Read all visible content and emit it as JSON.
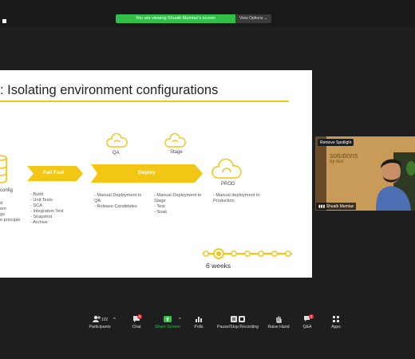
{
  "share_banner": {
    "text": "You are viewing Shuaib Mumtaz's screen",
    "view_options": "View Options"
  },
  "slide": {
    "title": ": Isolating environment configurations",
    "config_fragment": "config",
    "left_bullets": [
      "d",
      "ent",
      "gs",
      "e principle"
    ],
    "stages": {
      "fail_fast": "Fail Fast",
      "deploy": "Deploy",
      "qa": "QA",
      "stage": "Stage",
      "prod": "PROD"
    },
    "fail_fast_bullets": [
      "Build",
      "Unit Tests",
      "SCA",
      "Integration Test",
      "Snapshot",
      "Archive"
    ],
    "qa_bullets": [
      "Manual Deployment to QA",
      "Release Candidates"
    ],
    "stage_bullets": [
      "Manual Deployment to Stage",
      "Test",
      "Soak"
    ],
    "prod_bullets": [
      "Manual deployment to Production"
    ],
    "timeline": "6 weeks"
  },
  "video": {
    "remove_spotlight": "Remove Spotlight",
    "name": "Shuaib Mumtaz",
    "logo_lines": [
      "solutions",
      "by text"
    ]
  },
  "toolbar": {
    "participants": "Participants",
    "participants_count": "102",
    "chat": "Chat",
    "chat_badge": "1",
    "share": "Share Screen",
    "polls": "Polls",
    "recording": "Pause/Stop Recording",
    "raise_hand": "Raise Hand",
    "qa": "Q&A",
    "qa_badge": "1",
    "apps": "Apps"
  },
  "colors": {
    "accent_yellow": "#f2c614",
    "share_green": "#33c04a",
    "badge_red": "#e8333a"
  }
}
